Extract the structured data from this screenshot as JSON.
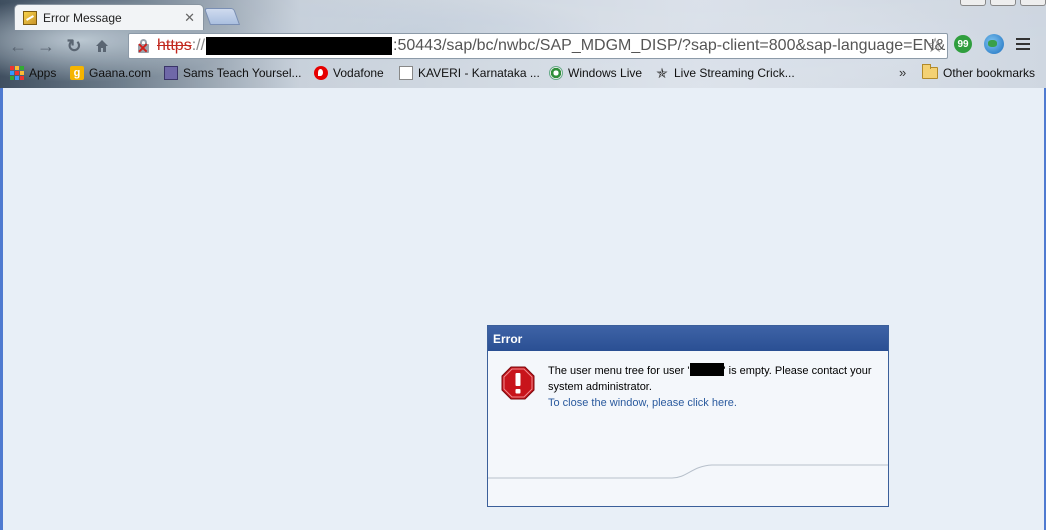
{
  "browser": {
    "tab": {
      "title": "Error Message"
    },
    "address": {
      "scheme": "https",
      "separator": "://",
      "rest": ":50443/sap/bc/nwbc/SAP_MDGM_DISP/?sap-client=800&sap-language=EN&"
    },
    "bookmarks": [
      {
        "label": "Apps",
        "icon": "apps-icon"
      },
      {
        "label": "Gaana.com",
        "icon": "gaana-icon"
      },
      {
        "label": "Sams Teach Yoursel...",
        "icon": "book-icon"
      },
      {
        "label": "Vodafone",
        "icon": "vodafone-icon"
      },
      {
        "label": "KAVERI - Karnataka ...",
        "icon": "page-icon"
      },
      {
        "label": "Windows Live",
        "icon": "windows-live-icon"
      },
      {
        "label": "Live Streaming Crick...",
        "icon": "runner-icon"
      }
    ],
    "overflow": "»",
    "other_bookmarks": "Other bookmarks"
  },
  "dialog": {
    "title": "Error",
    "message_before": "The user menu tree for user '",
    "message_after": "' is empty. Please contact your system administrator.",
    "link": "To close the window, please click here."
  },
  "colors": {
    "header": "#2a4f93",
    "link": "#2a5a9e",
    "error_icon": "#c8141b",
    "page_bg": "#e8eff7"
  }
}
